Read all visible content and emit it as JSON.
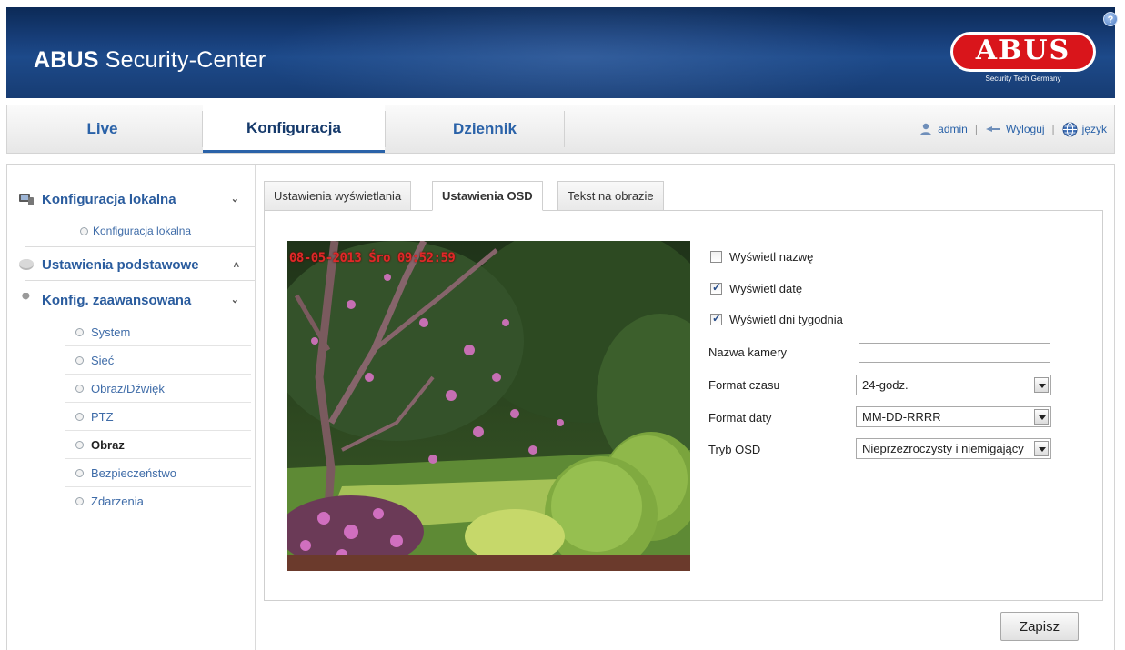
{
  "header": {
    "app_title_brand": "ABUS",
    "app_title_rest": " Security-Center",
    "logo_text": "ABUS",
    "logo_tagline": "Security Tech Germany",
    "help_glyph": "?"
  },
  "nav": {
    "tabs": [
      {
        "label": "Live"
      },
      {
        "label": "Konfiguracja",
        "active": true
      },
      {
        "label": "Dziennik"
      }
    ],
    "user_label": "admin",
    "logout_label": "Wyloguj",
    "language_label": "język"
  },
  "sidebar": {
    "local": {
      "label": "Konfiguracja lokalna",
      "sub": "Konfiguracja lokalna"
    },
    "basic": {
      "label": "Ustawienia podstawowe"
    },
    "advanced": {
      "label": "Konfig. zaawansowana"
    },
    "items": [
      {
        "label": "System"
      },
      {
        "label": "Sieć"
      },
      {
        "label": "Obraz/Dźwięk"
      },
      {
        "label": "PTZ"
      },
      {
        "label": "Obraz",
        "active": true
      },
      {
        "label": "Bezpieczeństwo"
      },
      {
        "label": "Zdarzenia"
      }
    ]
  },
  "tabs": [
    {
      "label": "Ustawienia wyświetlania"
    },
    {
      "label": "Ustawienia OSD",
      "active": true
    },
    {
      "label": "Tekst na obrazie"
    }
  ],
  "preview": {
    "osd_overlay": "08-05-2013 Śro 09:52:59"
  },
  "form": {
    "show_name": {
      "label": "Wyświetl nazwę",
      "checked": false
    },
    "show_date": {
      "label": "Wyświetl datę",
      "checked": true
    },
    "show_weekday": {
      "label": "Wyświetl dni tygodnia",
      "checked": true
    },
    "camera_name_label": "Nazwa kamery",
    "camera_name_value": "",
    "time_format_label": "Format czasu",
    "time_format_value": "24-godz.",
    "date_format_label": "Format daty",
    "date_format_value": "MM-DD-RRRR",
    "osd_mode_label": "Tryb OSD",
    "osd_mode_value": "Nieprzezroczysty i niemigający"
  },
  "save_label": "Zapisz",
  "colors": {
    "header_bg": "#173e79",
    "link_blue": "#2a62a8",
    "logo_red": "#d9151b",
    "osd_red": "#e02828"
  }
}
